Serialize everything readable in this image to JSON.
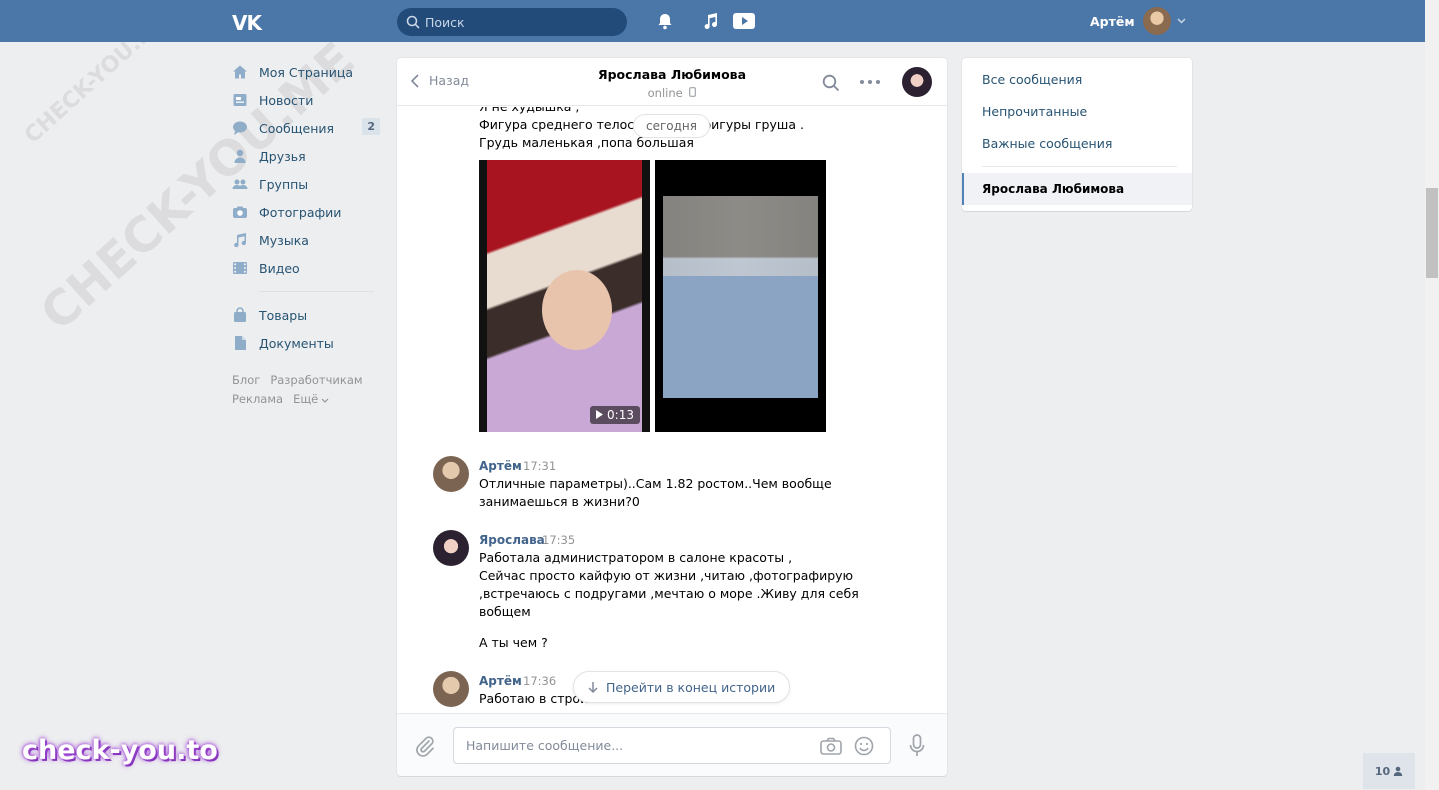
{
  "header": {
    "logo": "VK",
    "search_placeholder": "Поиск",
    "user_name": "Артём"
  },
  "sidebar": {
    "items": [
      {
        "label": "Моя Страница",
        "icon": "home-icon"
      },
      {
        "label": "Новости",
        "icon": "news-icon"
      },
      {
        "label": "Сообщения",
        "icon": "messages-icon",
        "badge": "2"
      },
      {
        "label": "Друзья",
        "icon": "friends-icon"
      },
      {
        "label": "Группы",
        "icon": "groups-icon"
      },
      {
        "label": "Фотографии",
        "icon": "camera-icon"
      },
      {
        "label": "Музыка",
        "icon": "music-icon"
      },
      {
        "label": "Видео",
        "icon": "video-icon"
      }
    ],
    "items2": [
      {
        "label": "Товары",
        "icon": "bag-icon"
      },
      {
        "label": "Документы",
        "icon": "document-icon"
      }
    ],
    "footer": [
      "Блог",
      "Разработчикам",
      "Реклама",
      "Ещё"
    ]
  },
  "chat": {
    "back_label": "Назад",
    "peer_name": "Ярослава Любимова",
    "peer_status": "online",
    "date_pill": "сегодня",
    "first_lines": [
      "Я не худышка ,",
      "Фигура среднего телосложения ,фигуры груша .",
      "Грудь маленькая ,попа большая"
    ],
    "video_duration": "0:13",
    "messages": [
      {
        "author": "Артём",
        "time": "17:31",
        "lines": [
          "Отличные параметры)..Сам 1.82 ростом..Чем вообще",
          "занимаешься в жизни?0"
        ]
      },
      {
        "author": "Ярослава",
        "time": "17:35",
        "lines": [
          "Работала администратором в салоне красоты ,",
          "Сейчас просто кайфую от жизни ,читаю ,фотографирую",
          ",встречаюсь с подругами ,мечтаю о море .Живу для себя",
          "вобщем"
        ],
        "extra": "А ты чем ?"
      },
      {
        "author": "Артём",
        "time": "17:36",
        "lines": [
          "Работаю в строи"
        ]
      }
    ],
    "jump_label": "Перейти в конец истории",
    "composer_placeholder": "Напишите сообщение..."
  },
  "rightnav": {
    "items": [
      "Все сообщения",
      "Непрочитанные",
      "Важные сообщения"
    ],
    "active": "Ярослава Любимова"
  },
  "watermark": "CHECK-YOU.ME",
  "brand": "check-you.to",
  "corner_badge": "10",
  "colors": {
    "header": "#4a76a8",
    "link": "#285473",
    "author": "#42648b",
    "background": "#edeef0"
  }
}
